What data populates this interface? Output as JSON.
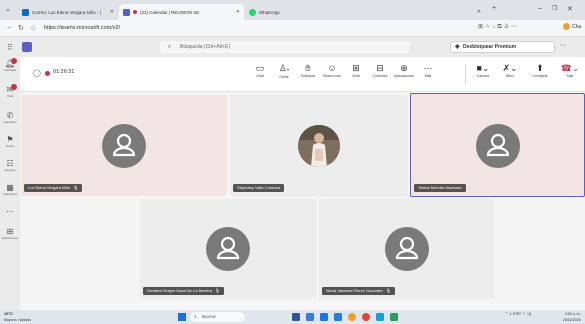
{
  "browser": {
    "tabs": [
      {
        "label": "Correo: Luz Elena Vergara Niño - (",
        "close": "✕"
      },
      {
        "label": "(23) Calendar | REUNION SE: ",
        "close": "✕"
      },
      {
        "label": "WhatsApp",
        "close": "✕"
      }
    ],
    "new_tab": "+",
    "url": "https://teams.microsoft.com/v2/",
    "copilot_label": "Cha"
  },
  "teams": {
    "search_placeholder": "Búsqueda (Ctrl+Alt+E)",
    "unblock_label": "Desbloquear Premium",
    "rail": [
      {
        "label": "Actividad",
        "icon": "bell-icon"
      },
      {
        "label": "Chat",
        "icon": "chat-icon"
      },
      {
        "label": "Llamadas",
        "icon": "phone-icon"
      },
      {
        "label": "Teams",
        "icon": "teams-icon"
      },
      {
        "label": "Equipos",
        "icon": "people-icon"
      },
      {
        "label": "Calendario",
        "icon": "calendar-icon"
      },
      {
        "label": "Aplicaciones",
        "icon": "apps-icon"
      }
    ]
  },
  "meeting": {
    "timer": "01:26:31",
    "toolbar": [
      {
        "label": "Chat",
        "icon": "chat-icon"
      },
      {
        "label": "Gente",
        "icon": "people-icon",
        "count": "9"
      },
      {
        "label": "Participar",
        "icon": "raise-hand-icon"
      },
      {
        "label": "Reaccionar",
        "icon": "smile-icon"
      },
      {
        "label": "Vista",
        "icon": "view-icon"
      },
      {
        "label": "Controles",
        "icon": "controls-icon"
      },
      {
        "label": "Aplicaciones",
        "icon": "plus-icon"
      },
      {
        "label": "Más",
        "icon": "more-icon"
      }
    ],
    "media": [
      {
        "label": "Cámara",
        "icon": "camera-off-icon"
      },
      {
        "label": "Micro",
        "icon": "mic-off-icon"
      },
      {
        "label": "Compartir",
        "icon": "share-icon"
      }
    ],
    "leave_label": "Salir",
    "participants": [
      {
        "name": "Luz Elena Vergara Niño",
        "type": "avatar"
      },
      {
        "name": "Stephany Vallo Cordoba",
        "type": "photo"
      },
      {
        "name": "Yesica Mendez Alvarado",
        "type": "avatar",
        "speaking": true
      },
      {
        "name": "Omaleni Grayer Daza De La Barrera",
        "type": "avatar"
      },
      {
        "name": "Nuvia Vanessa Florez Gonzalez",
        "type": "avatar"
      }
    ]
  },
  "taskbar": {
    "temp": "26°C",
    "weather": "Mayorm. nublado",
    "search_placeholder": "Buscar",
    "lang": "ESP",
    "region": "LAA",
    "time": "9:52 a. m.",
    "date": "25/02/2025"
  }
}
